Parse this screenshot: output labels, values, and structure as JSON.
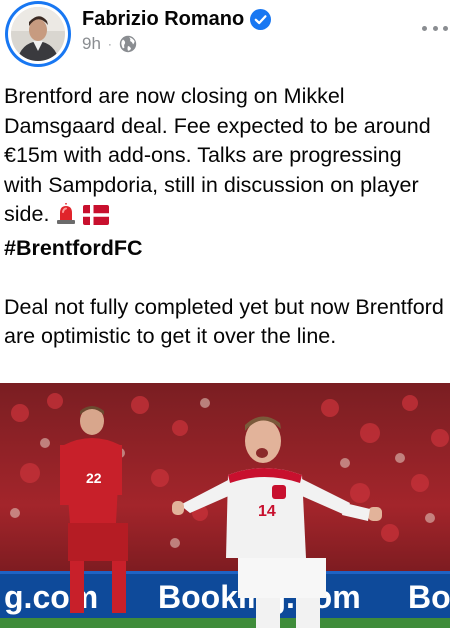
{
  "author": {
    "name": "Fabrizio Romano",
    "verified": true,
    "time": "9h",
    "separator": "·",
    "audience_icon": "globe-icon"
  },
  "post": {
    "paragraph1": "Brentford are now closing on Mikkel Damsgaard deal. Fee expected to be around €15m with add-ons. Talks are progressing with Sampdoria, still in discussion on player side.",
    "emojis": [
      "siren-icon",
      "denmark-flag-icon"
    ],
    "hashtag": "#BrentfordFC",
    "paragraph2": "Deal not fully completed yet but now Brentford are optimistic to get it over the line."
  },
  "photo": {
    "ad_board_left": "g.com",
    "ad_board_center": "Booking.com",
    "ad_board_right": "Boo",
    "player_number_left": "22",
    "player_number_right": "14"
  },
  "colors": {
    "brand_blue": "#1877f2",
    "meta_gray": "#8a8d91",
    "denmark_red": "#c8102e",
    "russia_red": "#c8202a",
    "ad_board_blue": "#0e4a9a"
  }
}
